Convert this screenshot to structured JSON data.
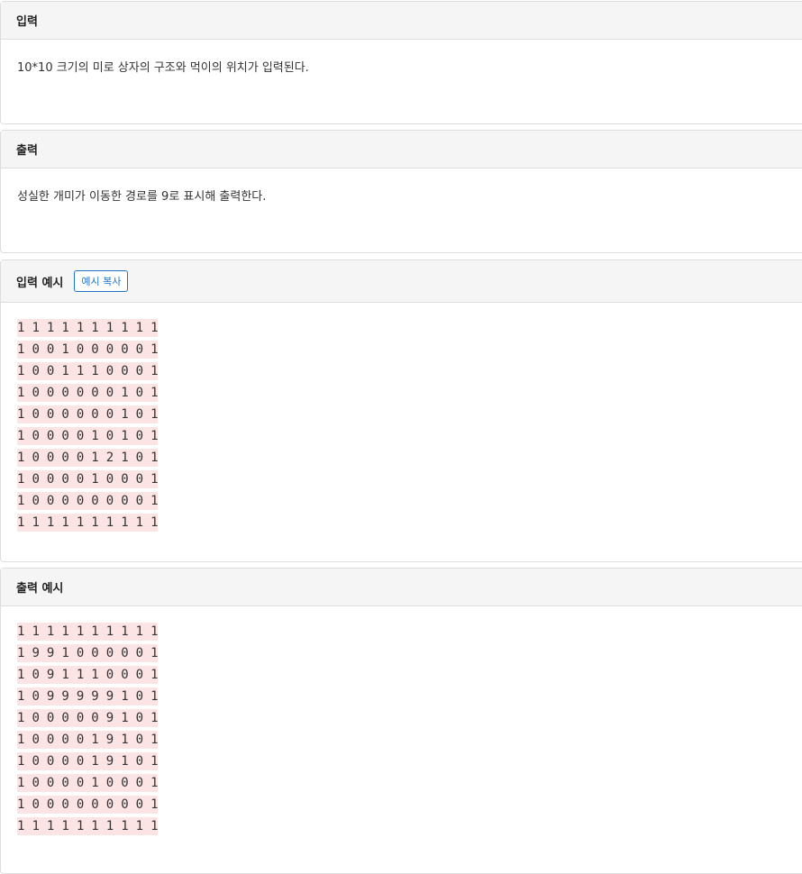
{
  "input_section": {
    "title": "입력",
    "description": "10*10 크기의 미로 상자의 구조와 먹이의 위치가 입력된다."
  },
  "output_section": {
    "title": "출력",
    "description": "성실한 개미가 이동한 경로를 9로 표시해 출력한다."
  },
  "sample_input": {
    "title": "입력 예시",
    "copy_button": "예시 복사",
    "lines": [
      "1 1 1 1 1 1 1 1 1 1",
      "1 0 0 1 0 0 0 0 0 1",
      "1 0 0 1 1 1 0 0 0 1",
      "1 0 0 0 0 0 0 1 0 1",
      "1 0 0 0 0 0 0 1 0 1",
      "1 0 0 0 0 1 0 1 0 1",
      "1 0 0 0 0 1 2 1 0 1",
      "1 0 0 0 0 1 0 0 0 1",
      "1 0 0 0 0 0 0 0 0 1",
      "1 1 1 1 1 1 1 1 1 1"
    ]
  },
  "sample_output": {
    "title": "출력 예시",
    "lines": [
      "1 1 1 1 1 1 1 1 1 1",
      "1 9 9 1 0 0 0 0 0 1",
      "1 0 9 1 1 1 0 0 0 1",
      "1 0 9 9 9 9 9 1 0 1",
      "1 0 0 0 0 0 9 1 0 1",
      "1 0 0 0 0 1 9 1 0 1",
      "1 0 0 0 0 1 9 1 0 1",
      "1 0 0 0 0 1 0 0 0 1",
      "1 0 0 0 0 0 0 0 0 1",
      "1 1 1 1 1 1 1 1 1 1"
    ]
  }
}
